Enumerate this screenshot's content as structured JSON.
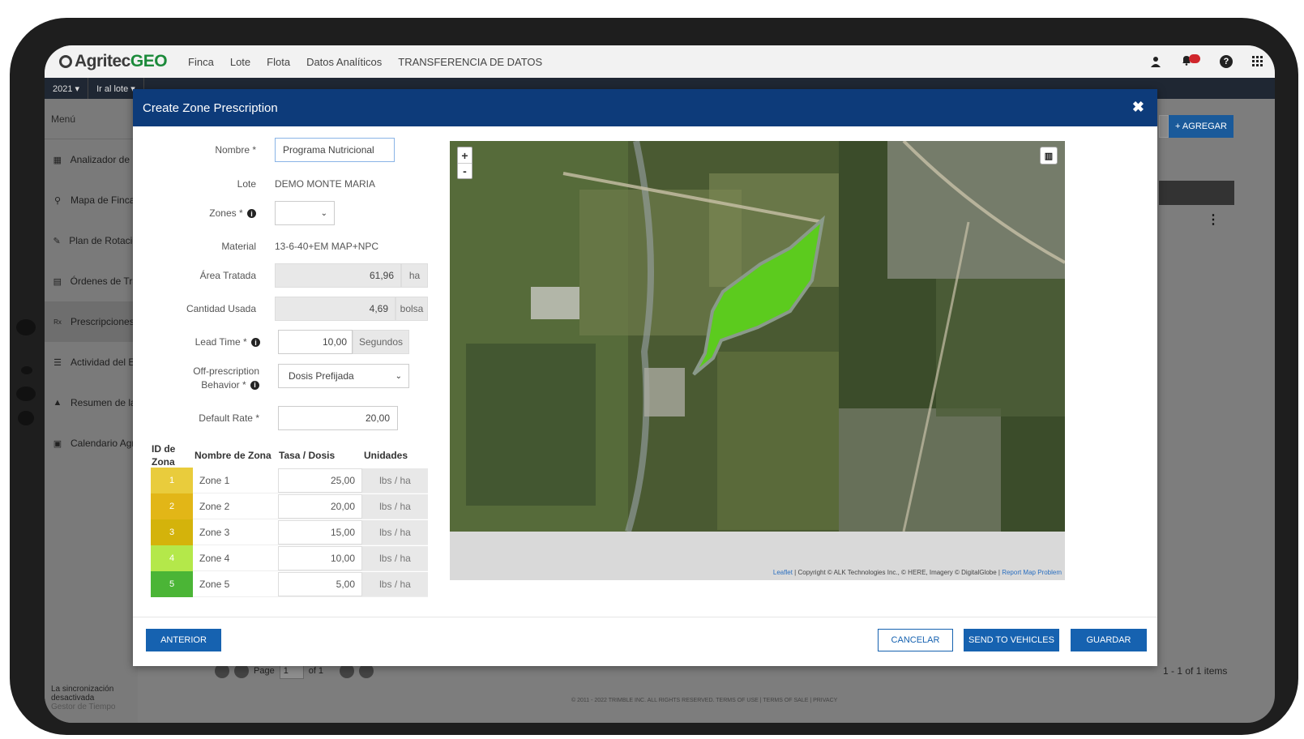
{
  "app": {
    "logo_prefix": "Agritec",
    "logo_suffix": "GEO",
    "nav": [
      "Finca",
      "Lote",
      "Flota",
      "Datos Analíticos",
      "TRANSFERENCIA DE DATOS"
    ]
  },
  "subbar": {
    "year": "2021 ▾",
    "goto": "Ir al lote ▾"
  },
  "sidebar": {
    "title": "Menú",
    "items": [
      {
        "label": "Analizador de L"
      },
      {
        "label": "Mapa de Finca"
      },
      {
        "label": "Plan de Rotació"
      },
      {
        "label": "Órdenes de Tra"
      },
      {
        "label": "Prescripciones",
        "icon": "Rx"
      },
      {
        "label": "Actividad del E"
      },
      {
        "label": "Resumen de la"
      },
      {
        "label": "Calendario Agri"
      }
    ],
    "sync_status": "La sincronización desactivada",
    "sync_sub": "Gestor de Tiempo"
  },
  "background": {
    "add_button": "+ AGREGAR",
    "pager": {
      "page_label": "Page",
      "page_value": "1",
      "of_label": "of 1"
    },
    "items_count": "1 - 1 of 1 items",
    "footer": "© 2011 - 2022 TRIMBLE INC. ALL RIGHTS RESERVED.   TERMS OF USE  |  TERMS OF SALE  |  PRIVACY"
  },
  "modal": {
    "title": "Create Zone Prescription",
    "close_icon": "✖",
    "fields": {
      "nombre": {
        "label": "Nombre *",
        "value": "Programa Nutricional"
      },
      "lote": {
        "label": "Lote",
        "value": "DEMO MONTE MARIA"
      },
      "zones": {
        "label": "Zones *",
        "value": ""
      },
      "material": {
        "label": "Material",
        "value": "13-6-40+EM MAP+NPC"
      },
      "area": {
        "label": "Área Tratada",
        "value": "61,96",
        "unit": "ha"
      },
      "cantidad": {
        "label": "Cantidad Usada",
        "value": "4,69",
        "unit": "bolsa"
      },
      "lead_time": {
        "label": "Lead Time *",
        "value": "10,00",
        "unit": "Segundos"
      },
      "off_prescription": {
        "label_line1": "Off-prescription",
        "label_line2": "Behavior *",
        "value": "Dosis Prefijada"
      },
      "default_rate": {
        "label": "Default Rate *",
        "value": "20,00"
      }
    },
    "zone_table": {
      "headers": {
        "id_line1": "ID de",
        "id_line2": "Zona",
        "name": "Nombre de Zona",
        "rate": "Tasa / Dosis",
        "units": "Unidades"
      },
      "rows": [
        {
          "id": "1",
          "name": "Zone 1",
          "rate": "25,00",
          "unit": "lbs / ha",
          "color": "#e9cc3c"
        },
        {
          "id": "2",
          "name": "Zone 2",
          "rate": "20,00",
          "unit": "lbs / ha",
          "color": "#e2b617"
        },
        {
          "id": "3",
          "name": "Zone 3",
          "rate": "15,00",
          "unit": "lbs / ha",
          "color": "#d4b30b"
        },
        {
          "id": "4",
          "name": "Zone 4",
          "rate": "10,00",
          "unit": "lbs / ha",
          "color": "#b4e84a"
        },
        {
          "id": "5",
          "name": "Zone 5",
          "rate": "5,00",
          "unit": "lbs / ha",
          "color": "#4bb536"
        }
      ]
    },
    "map": {
      "zoom_in": "+",
      "zoom_out": "-",
      "attribution_leaflet": "Leaflet",
      "attribution_text": " | Copyright © ALK Technologies Inc., © HERE, Imagery © DigitalGlobe | ",
      "attribution_report": "Report Map Problem",
      "field_color": "#5ccb1e"
    },
    "buttons": {
      "previous": "ANTERIOR",
      "cancel": "CANCELAR",
      "send": "SEND TO VEHICLES",
      "save": "GUARDAR"
    }
  }
}
